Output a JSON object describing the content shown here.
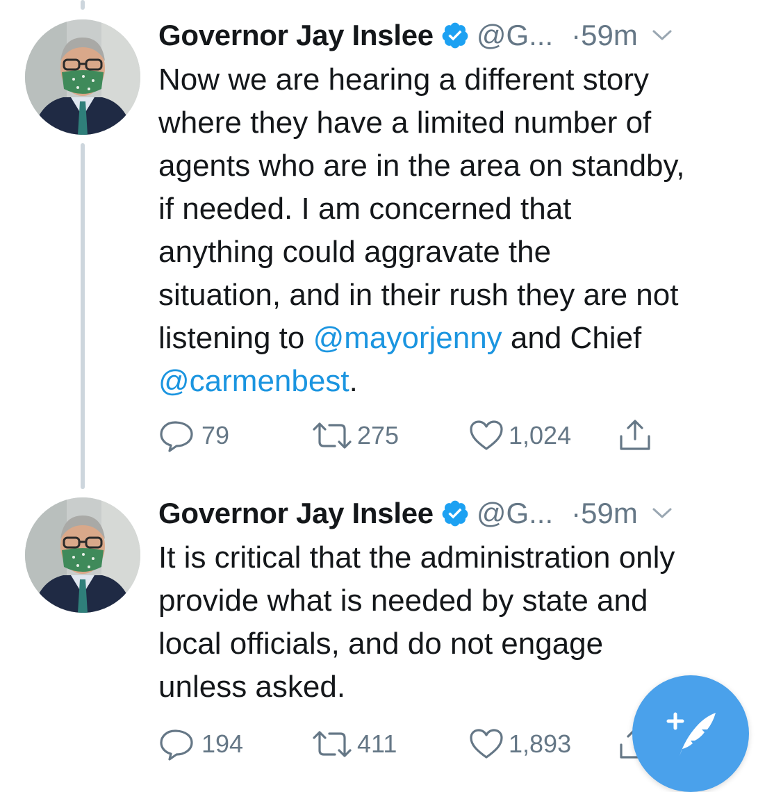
{
  "tweets": [
    {
      "author_name": "Governor Jay Inslee",
      "handle": "@G...",
      "time": "·59m",
      "lines": [
        [
          {
            "text": "Now we are hearing a different story"
          }
        ],
        [
          {
            "text": "where they have a limited number of"
          }
        ],
        [
          {
            "text": "agents who are in the area on standby,"
          }
        ],
        [
          {
            "text": "if needed. I am concerned that"
          }
        ],
        [
          {
            "text": "anything could aggravate the"
          }
        ],
        [
          {
            "text": "situation, and in their rush they are not"
          }
        ],
        [
          {
            "text": "listening to "
          },
          {
            "text": "@mayorjenny",
            "mention": true
          },
          {
            "text": " and Chief"
          }
        ],
        [
          {
            "text": "@carmenbest",
            "mention": true
          },
          {
            "text": "."
          }
        ]
      ],
      "replies": "79",
      "retweets": "275",
      "likes": "1,024"
    },
    {
      "author_name": "Governor Jay Inslee",
      "handle": "@G...",
      "time": "·59m",
      "lines": [
        [
          {
            "text": "It is critical that the administration only"
          }
        ],
        [
          {
            "text": "provide what is needed by state and"
          }
        ],
        [
          {
            "text": "local officials, and do not engage"
          }
        ],
        [
          {
            "text": "unless asked."
          }
        ]
      ],
      "replies": "194",
      "retweets": "411",
      "likes": "1,893"
    }
  ],
  "colors": {
    "text": "#14171a",
    "secondary": "#657786",
    "mention": "#1b95e0",
    "verified": "#1da1f2",
    "thread_line": "#cdd6dd",
    "fab": "#4aa1eb",
    "mask": "#3f8a5a"
  },
  "icons": {
    "reply": "speech-bubble-icon",
    "retweet": "retweet-arrows-icon",
    "like": "heart-icon",
    "share": "share-upload-icon",
    "compose": "compose-feather-plus-icon",
    "verified": "verified-badge-icon",
    "more": "chevron-down-icon"
  }
}
